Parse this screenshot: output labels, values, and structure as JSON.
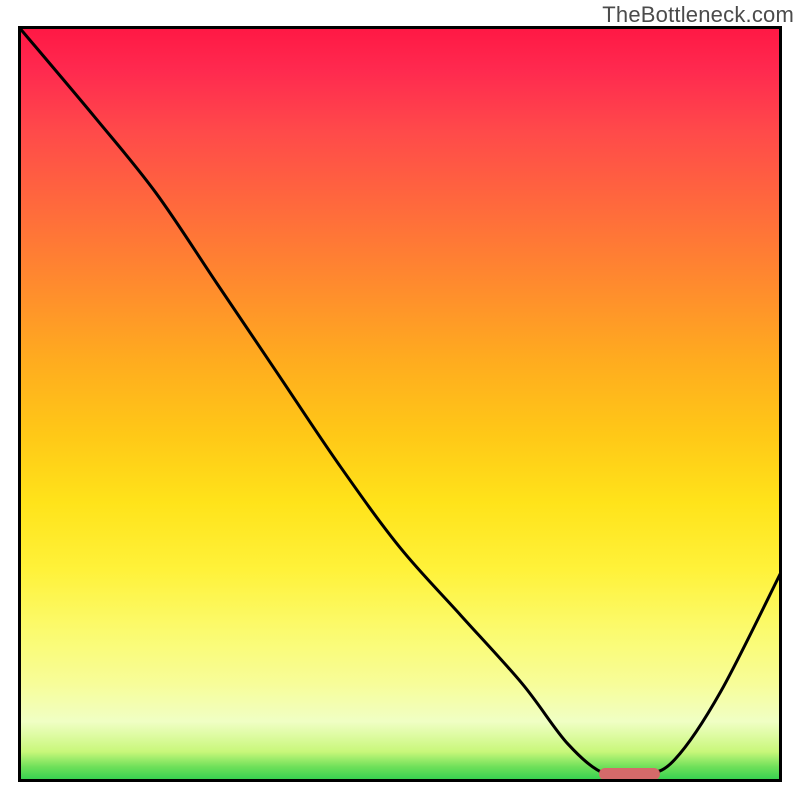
{
  "watermark": "TheBottleneck.com",
  "chart_data": {
    "type": "line",
    "title": "",
    "xlabel": "",
    "ylabel": "",
    "xlim": [
      0,
      100
    ],
    "ylim": [
      0,
      100
    ],
    "grid": false,
    "legend": false,
    "background": "vertical-gradient red-to-green (bottleneck severity)",
    "series": [
      {
        "name": "bottleneck-curve",
        "x": [
          0,
          10,
          18,
          26,
          34,
          42,
          50,
          58,
          66,
          72,
          77,
          82,
          86,
          92,
          100
        ],
        "y": [
          100,
          88,
          78,
          66,
          54,
          42,
          31,
          22,
          13,
          5,
          1,
          1,
          3,
          12,
          28
        ]
      }
    ],
    "marker": {
      "name": "optimal-range",
      "x_start": 76,
      "x_end": 84,
      "y": 1,
      "color": "#d46a6a"
    },
    "gradient_stops": [
      {
        "pos": 0,
        "color": "#ff1744"
      },
      {
        "pos": 14,
        "color": "#ff4a4a"
      },
      {
        "pos": 34,
        "color": "#ff8a2e"
      },
      {
        "pos": 54,
        "color": "#ffc817"
      },
      {
        "pos": 72,
        "color": "#fff23a"
      },
      {
        "pos": 87,
        "color": "#f7fd99"
      },
      {
        "pos": 96,
        "color": "#c8f77a"
      },
      {
        "pos": 100,
        "color": "#2bcf4e"
      }
    ]
  }
}
